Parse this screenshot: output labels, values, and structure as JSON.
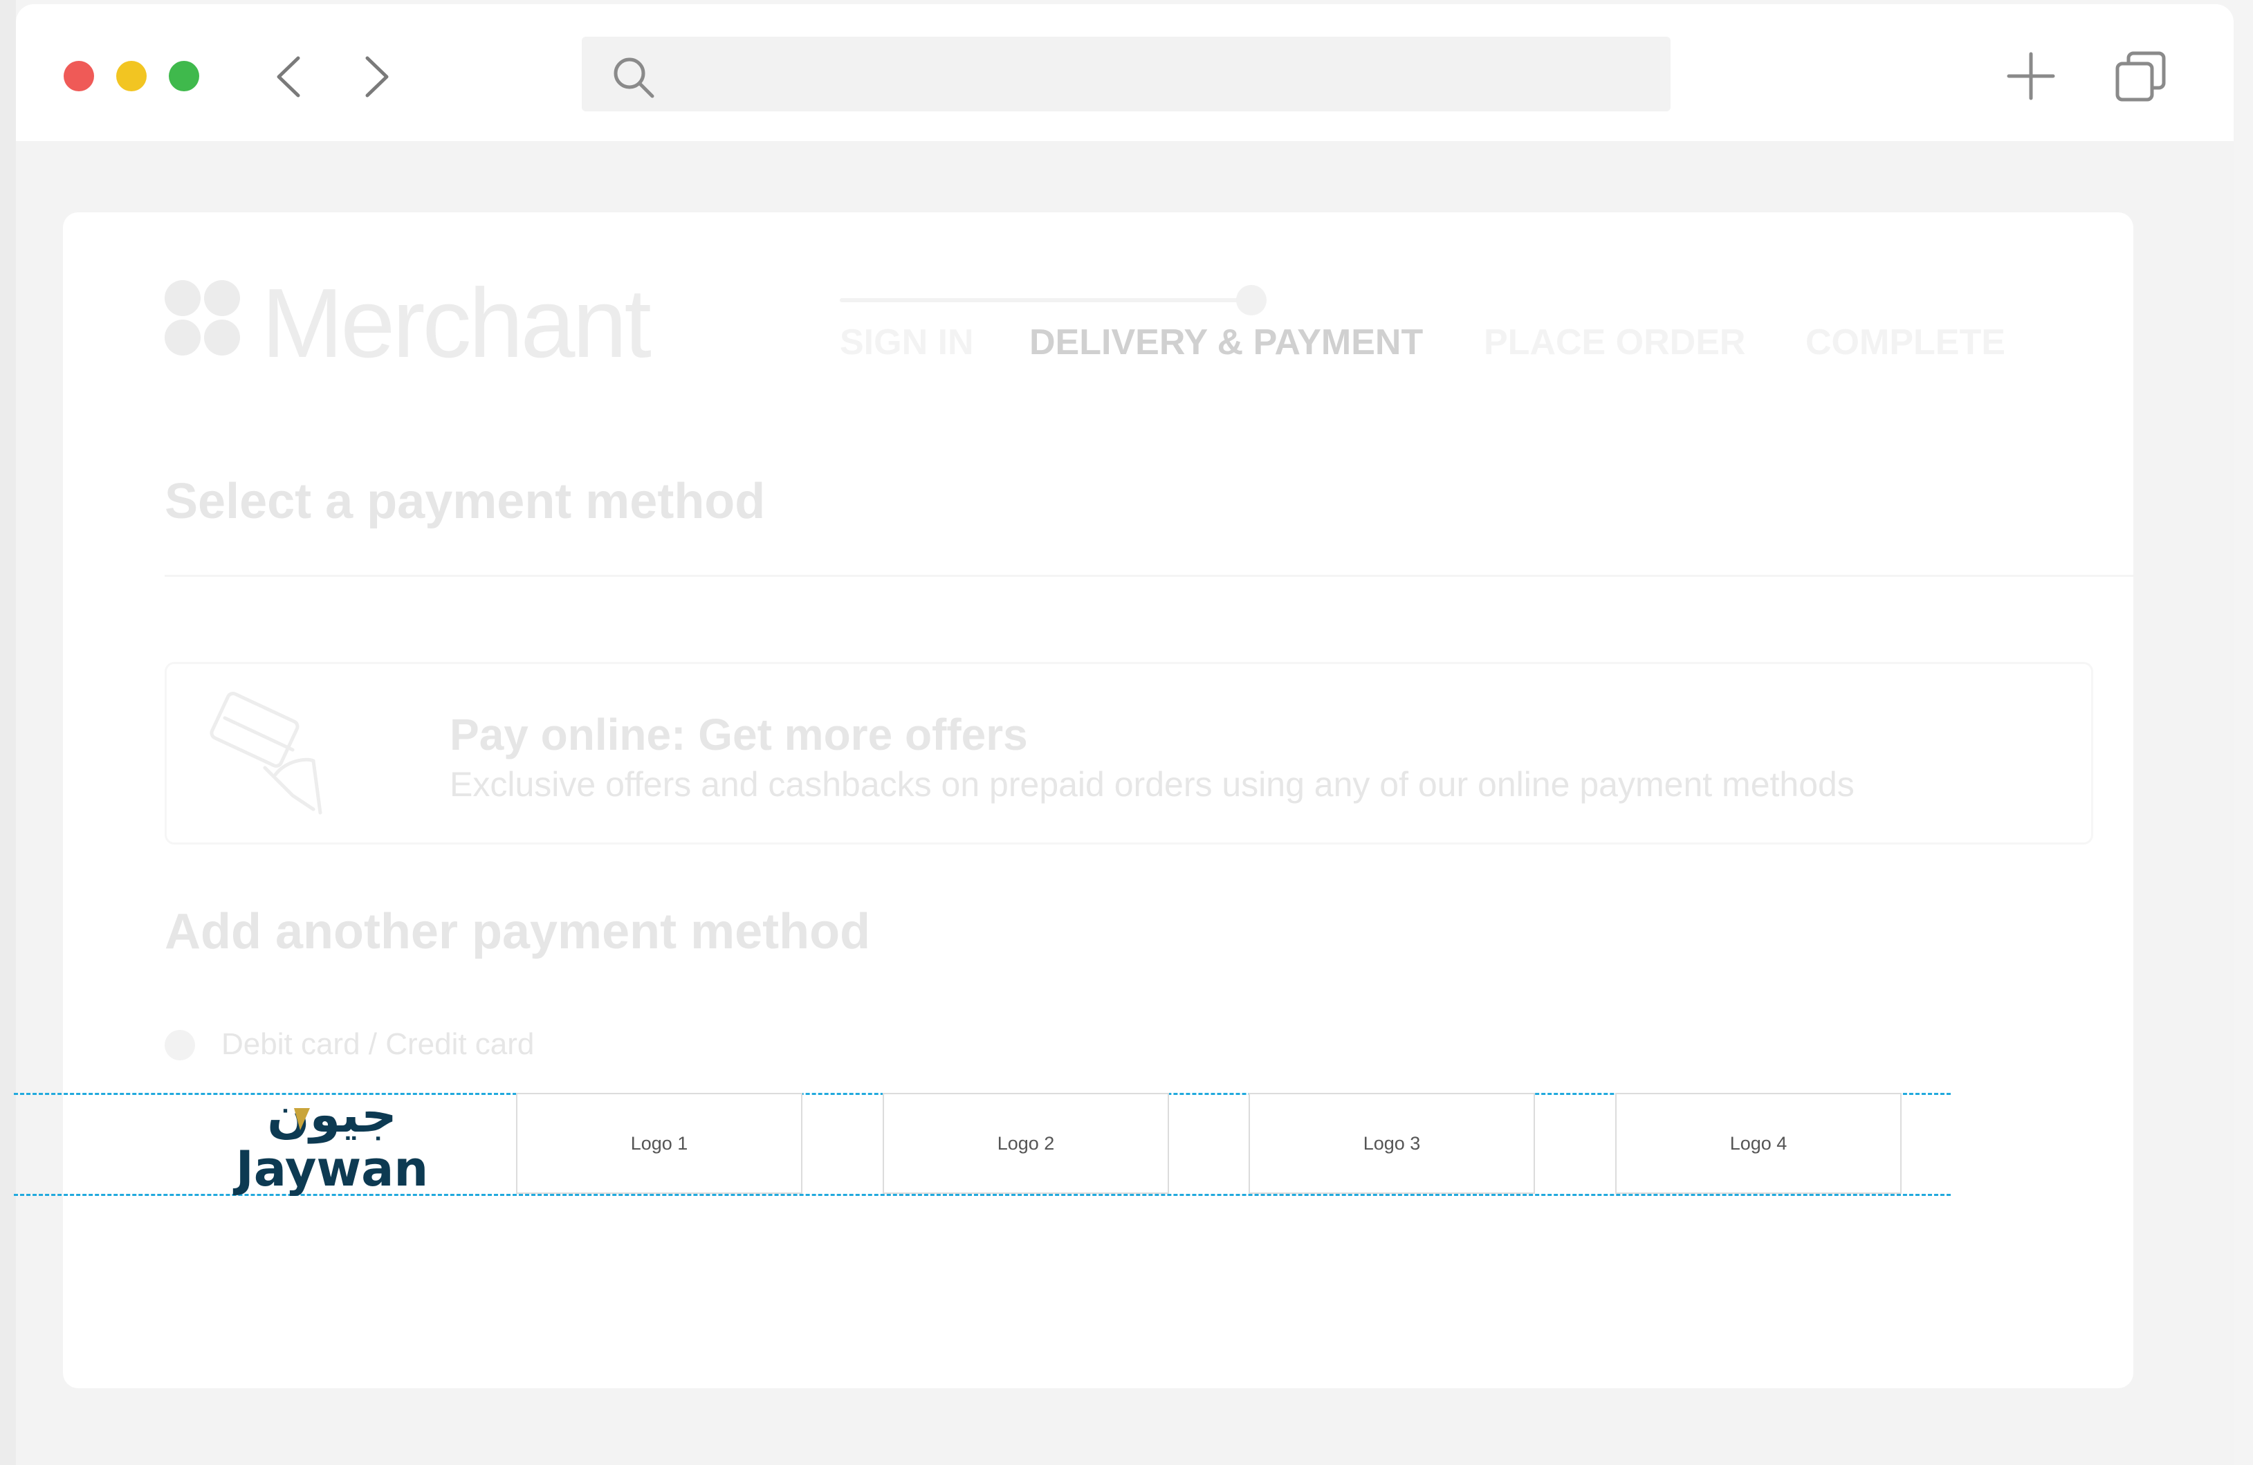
{
  "browser": {
    "buttons": {
      "back": "back-arrow",
      "forward": "forward-arrow",
      "new_tab": "plus",
      "tabs_overview": "tabs"
    },
    "address_bar": {
      "placeholder": "",
      "icon": "search-icon"
    },
    "traffic_lights": {
      "close": "#ef5a57",
      "minimize": "#f2c522",
      "zoom": "#3fb94c"
    }
  },
  "merchant": {
    "brand_name": "Merchant",
    "steps": [
      {
        "label": "SIGN IN",
        "state": "done"
      },
      {
        "label": "DELIVERY & PAYMENT",
        "state": "active"
      },
      {
        "label": "PLACE ORDER",
        "state": "upcoming"
      },
      {
        "label": "COMPLETE",
        "state": "upcoming"
      }
    ],
    "section_title": "Select a payment method",
    "offer": {
      "title": "Pay online: Get more offers",
      "subtitle": "Exclusive offers and cashbacks on prepaid orders using any of our online payment methods"
    },
    "add_method_title": "Add another payment method",
    "payment_option_label": "Debit card / Credit card"
  },
  "logo_row": {
    "brand_latin": "Jaywan",
    "brand_arabic": "جيون",
    "placeholders": [
      "Logo 1",
      "Logo 2",
      "Logo 3",
      "Logo 4"
    ],
    "guide_color": "#21a9dd",
    "jaywan_navy": "#0d3a52",
    "jaywan_gold": "#c9a43a"
  }
}
